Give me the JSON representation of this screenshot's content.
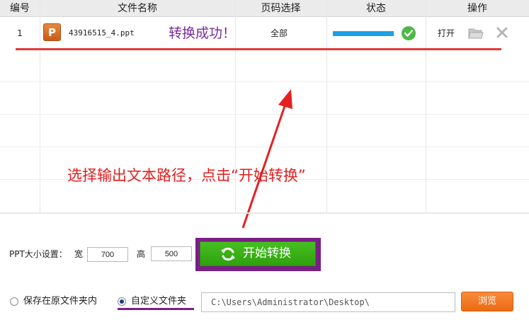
{
  "table": {
    "columns": [
      "编号",
      "文件名称",
      "页码选择",
      "状态",
      "操作"
    ],
    "rows": [
      {
        "index": "1",
        "icon": "ppt-file-icon",
        "icon_letter": "P",
        "filename": "43916515_4.ppt",
        "pages": "全部",
        "progress_percent": 100,
        "status_icon": "check-circle-icon",
        "open_label": "打开"
      }
    ]
  },
  "annotations": {
    "success_text": "转换成功！",
    "hint_text": "选择输出文本路径，点击“开始转换”"
  },
  "settings": {
    "size_label": "PPT大小设置：",
    "width_label": "宽",
    "width_value": "700",
    "height_label": "高",
    "height_value": "500",
    "start_button": "开始转换"
  },
  "output": {
    "option_original": "保存在原文件夹内",
    "option_custom": "自定义文件夹",
    "selected": "custom",
    "path": "C:\\Users\\Administrator\\Desktop\\",
    "browse_label": "浏览"
  },
  "colors": {
    "accent_green": "#3bb01a",
    "accent_orange": "#f27a24",
    "annotation_red": "#e02020",
    "annotation_purple": "#7a1f86",
    "progress_blue": "#1aa0e8"
  }
}
